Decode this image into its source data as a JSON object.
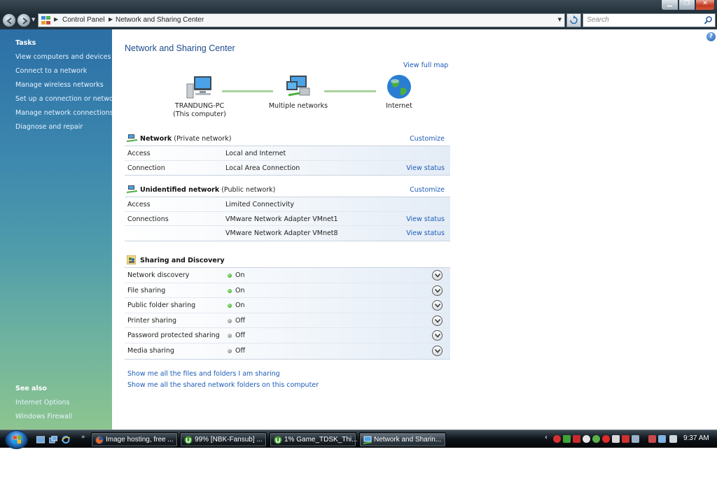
{
  "address": {
    "crumbs": [
      "Control Panel",
      "Network and Sharing Center"
    ],
    "search_placeholder": "Search"
  },
  "sidebar": {
    "tasks_heading": "Tasks",
    "tasks": [
      "View computers and devices",
      "Connect to a network",
      "Manage wireless networks",
      "Set up a connection or network",
      "Manage network connections",
      "Diagnose and repair"
    ],
    "see_also_heading": "See also",
    "see_also": [
      "Internet Options",
      "Windows Firewall"
    ]
  },
  "main": {
    "title": "Network and Sharing Center",
    "view_full_map": "View full map",
    "map": {
      "computer_name": "TRANDUNG-PC",
      "computer_sub": "(This computer)",
      "middle": "Multiple networks",
      "internet": "Internet"
    },
    "networks": [
      {
        "name": "Network",
        "type": " (Private network)",
        "customize": "Customize",
        "rows": [
          {
            "label": "Access",
            "value": "Local and Internet",
            "action": ""
          },
          {
            "label": "Connection",
            "value": "Local Area Connection",
            "action": "View status"
          }
        ]
      },
      {
        "name": "Unidentified network",
        "type": " (Public network)",
        "customize": "Customize",
        "rows": [
          {
            "label": "Access",
            "value": "Limited Connectivity",
            "action": ""
          },
          {
            "label": "Connections",
            "value": "VMware Network Adapter VMnet1",
            "action": "View status"
          },
          {
            "label": "",
            "value": "VMware Network Adapter VMnet8",
            "action": "View status"
          }
        ]
      }
    ],
    "sharing": {
      "title": "Sharing and Discovery",
      "items": [
        {
          "label": "Network discovery",
          "state": "On"
        },
        {
          "label": "File sharing",
          "state": "On"
        },
        {
          "label": "Public folder sharing",
          "state": "On"
        },
        {
          "label": "Printer sharing",
          "state": "Off"
        },
        {
          "label": "Password protected sharing",
          "state": "Off"
        },
        {
          "label": "Media sharing",
          "state": "Off"
        }
      ]
    },
    "bottom_links": [
      "Show me all the files and folders I am sharing",
      "Show me all the shared network folders on this computer"
    ]
  },
  "taskbar": {
    "tasks": [
      {
        "label": "Image hosting, free ...",
        "icon": "firefox-icon",
        "active": false
      },
      {
        "label": "99% [NBK-Fansub] ...",
        "icon": "utorrent-icon",
        "active": false
      },
      {
        "label": "1% Game_TDSK_Thi...",
        "icon": "utorrent-icon",
        "active": false
      },
      {
        "label": "Network and Sharin...",
        "icon": "network-center-icon",
        "active": true
      }
    ],
    "clock": "9:37 AM"
  },
  "colors": {
    "link": "#1c5bb5",
    "title": "#1e4c8c",
    "status_on": "#2c9a1c",
    "status_off": "#7b7b7b"
  }
}
